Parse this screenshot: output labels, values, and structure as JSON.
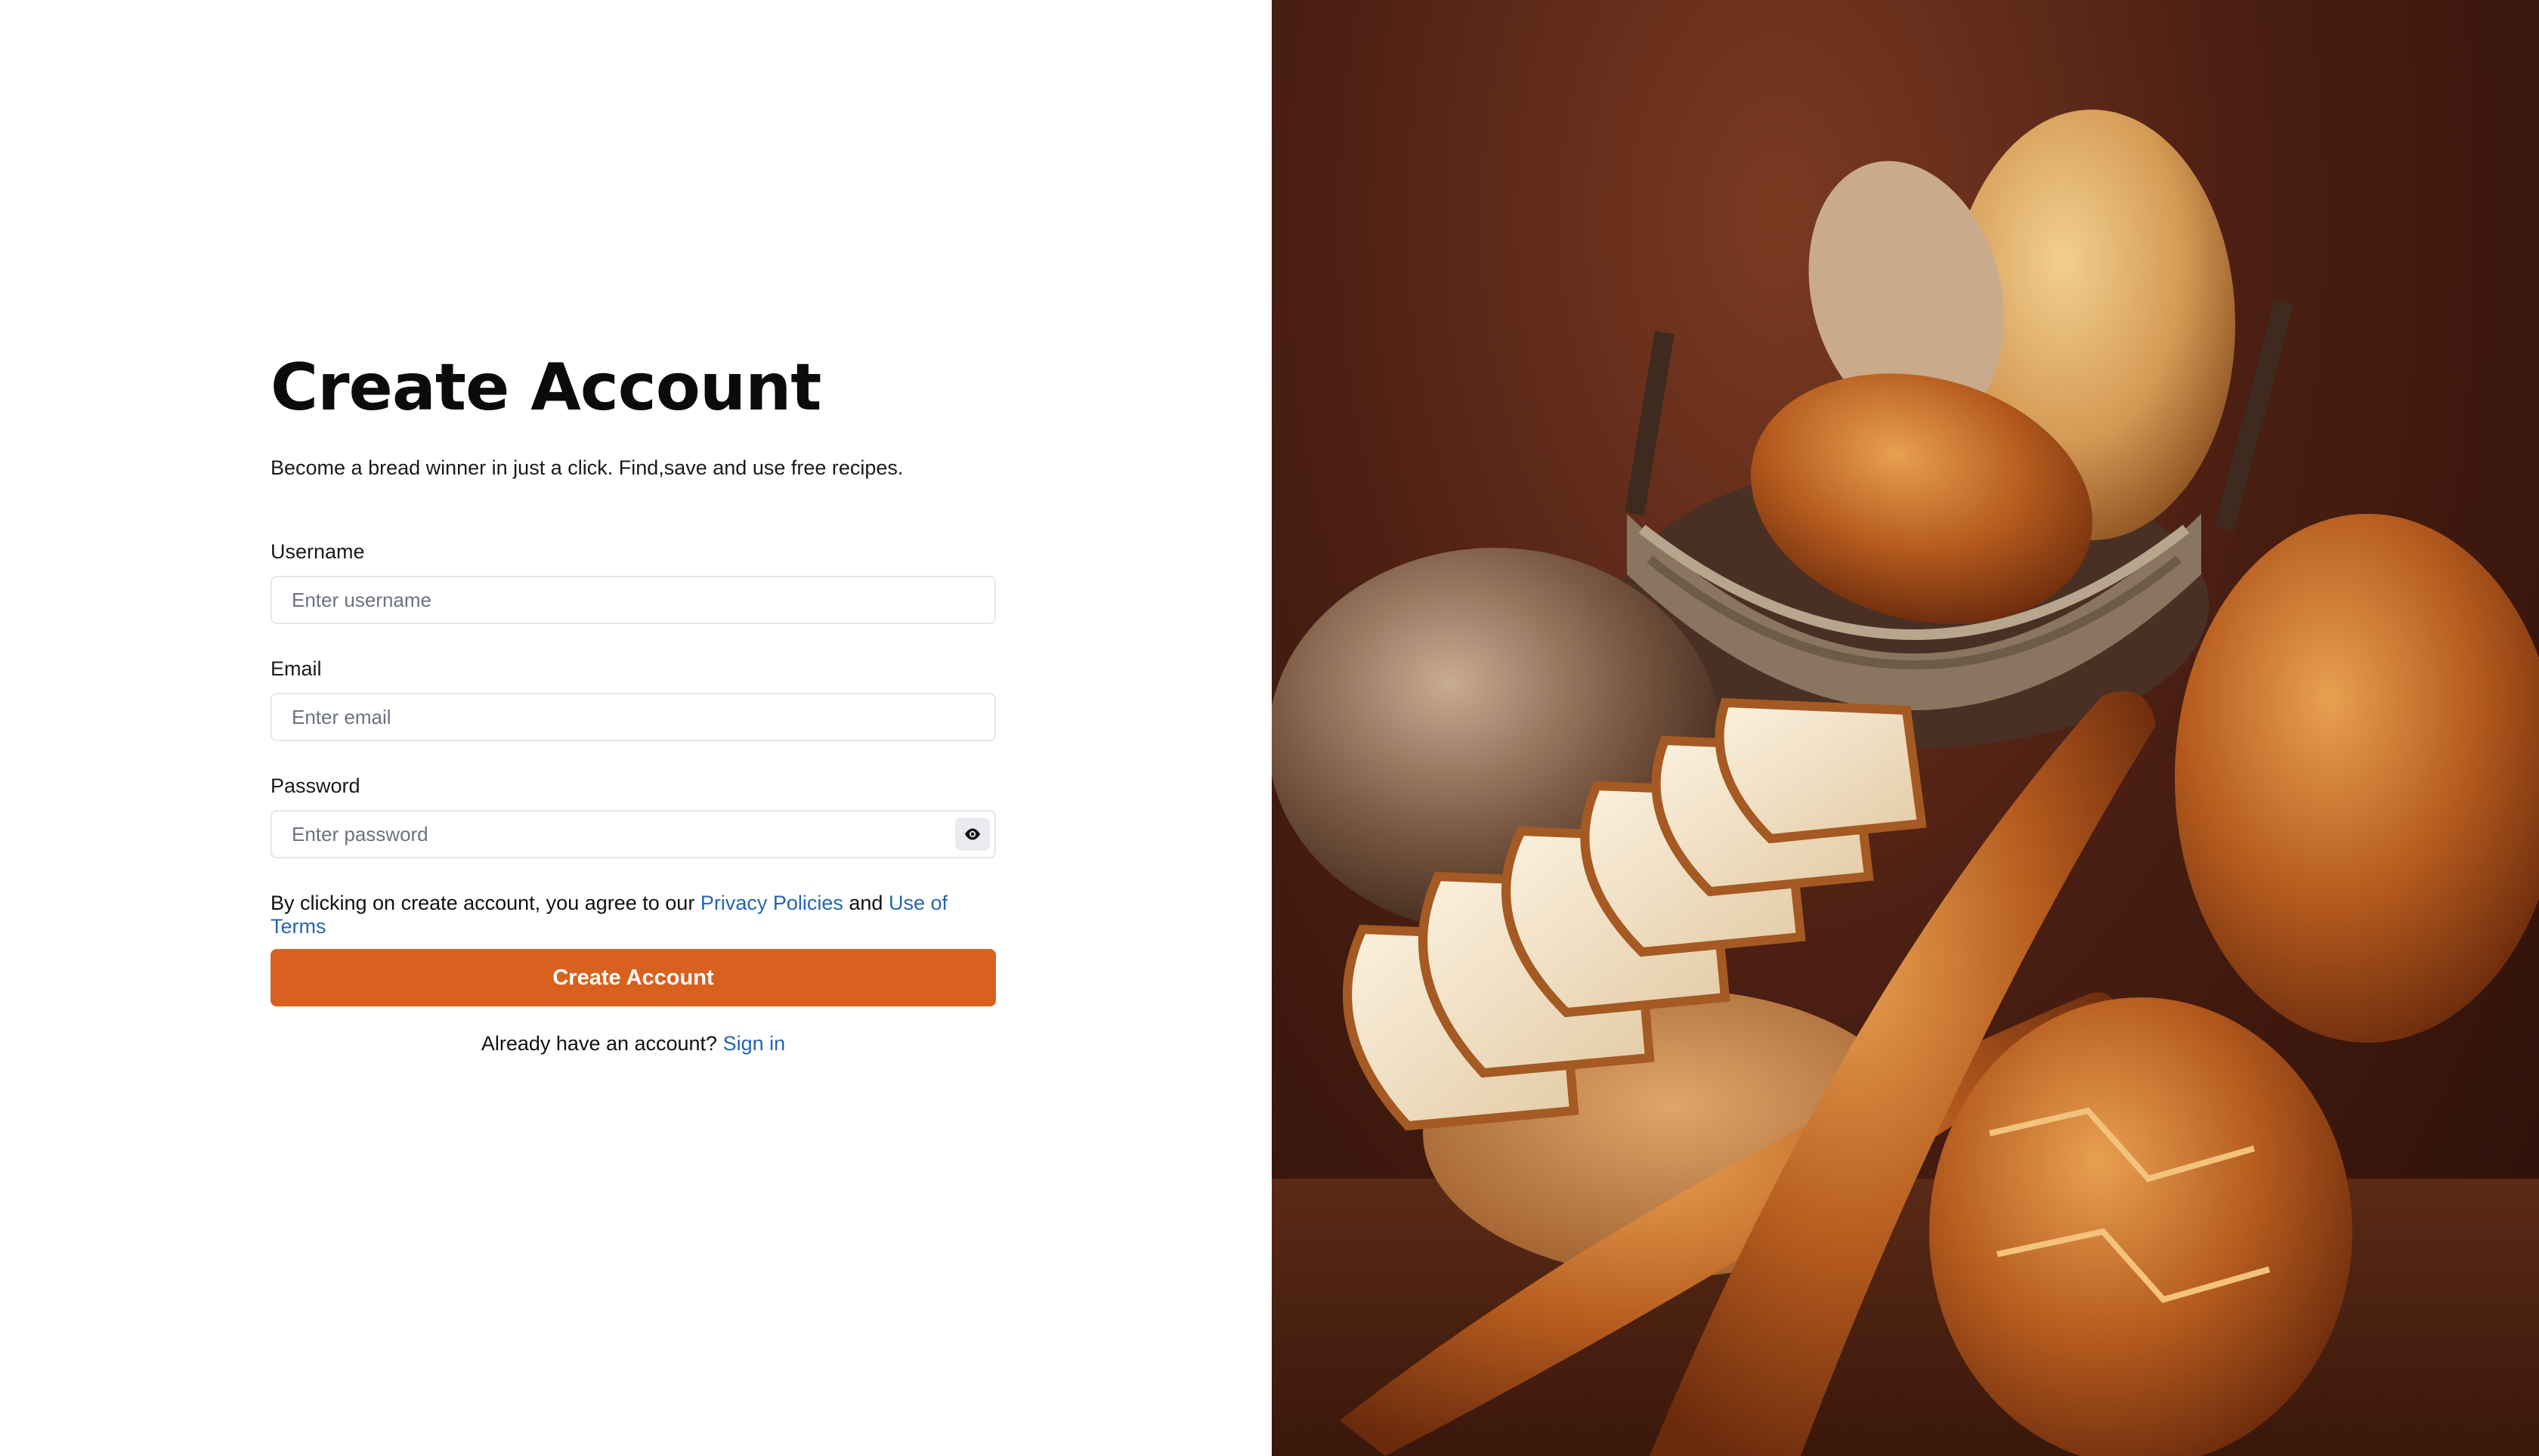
{
  "form": {
    "title": "Create Account",
    "subtitle": "Become a bread winner in just a click. Find,save and use free recipes.",
    "username": {
      "label": "Username",
      "placeholder": "Enter username"
    },
    "email": {
      "label": "Email",
      "placeholder": "Enter email"
    },
    "password": {
      "label": "Password",
      "placeholder": "Enter password",
      "toggle_icon": "eye-icon"
    },
    "terms": {
      "prefix": "By clicking on create account, you agree to our ",
      "privacy_link": "Privacy Policies",
      "conjunction": " and ",
      "terms_link": "Use of Terms"
    },
    "submit_label": "Create Account",
    "signin": {
      "prompt": "Already have an account? ",
      "link": "Sign in"
    }
  },
  "colors": {
    "accent": "#d8611f",
    "link": "#2566b0",
    "input_border": "#e5e7eb"
  }
}
